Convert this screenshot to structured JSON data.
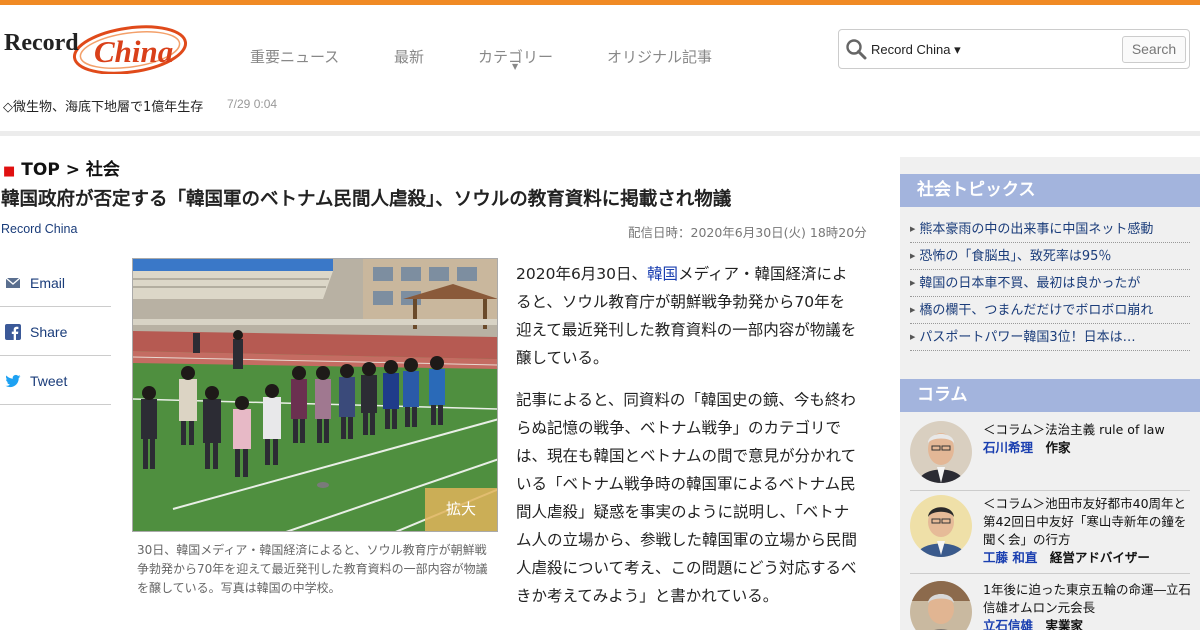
{
  "brand": {
    "logo_part1": "Record",
    "logo_part2": "China",
    "accent_color": "#f08a24"
  },
  "nav": {
    "items": [
      "重要ニュース",
      "最新",
      "カテゴリー",
      "オリジナル記事"
    ]
  },
  "search": {
    "scope": "Record China ▾",
    "button": "Search"
  },
  "ticker": {
    "text": "◇微生物、海底下地層で1億年生存",
    "time": "7/29 0:04"
  },
  "breadcrumb": {
    "top": "TOP",
    "sep": ">",
    "section": "社会"
  },
  "article": {
    "title": "韓国政府が否定する「韓国軍のベトナム民間人虐殺」、ソウルの教育資料に掲載され物議",
    "source": "Record China",
    "date": "配信日時：2020年6月30日(火) 18時20分",
    "zoom_label": "拡大",
    "caption": "30日、韓国メディア・韓国経済によると、ソウル教育庁が朝鮮戦争勃発から70年を迎えて最近発刊した教育資料の一部内容が物議を醸している。写真は韓国の中学校。",
    "p1_a": "2020年6月30日、",
    "p1_link": "韓国",
    "p1_b": "メディア・韓国経済によると、ソウル教育庁が朝鮮戦争勃発から70年を迎えて最近発刊した教育資料の一部内容が物議を醸している。",
    "p2": "記事によると、同資料の「韓国史の鏡、今も終わらぬ記憶の戦争、ベトナム戦争」のカテゴリでは、現在も韓国とベトナムの間で意見が分かれている「ベトナム戦争時の韓国軍によるベトナム民間人虐殺」疑惑を事実のように説明し、「ベトナム人の立場から、参戦した韓国軍の立場から民間人虐殺について考え、この問題にどう対応するべきか考えてみよう」と書かれている。"
  },
  "share": {
    "email": "Email",
    "facebook": "Share",
    "twitter": "Tweet"
  },
  "sidebar": {
    "topics_title": "社会トピックス",
    "topics": [
      "熊本豪雨の中の出来事に中国ネット感動",
      "恐怖の「食脳虫」、致死率は95％",
      "韓国の日本車不買、最初は良かったが",
      "橋の欄干、つまんだだけでボロボロ崩れ",
      "パスポートパワー韓国3位！日本は…"
    ],
    "column_title": "コラム",
    "columns": [
      {
        "headline": "＜コラム＞法治主義 rule of law",
        "author": "石川希理",
        "role": "作家"
      },
      {
        "headline": "＜コラム＞池田市友好都市40周年と第42回日中友好「寒山寺新年の鐘を聞く会」の行方",
        "author": "工藤 和直",
        "role": "経営アドバイザー"
      },
      {
        "headline": "1年後に迫った東京五輪の命運―立石信雄オムロン元会長",
        "author": "立石信雄",
        "role": "実業家"
      }
    ]
  }
}
